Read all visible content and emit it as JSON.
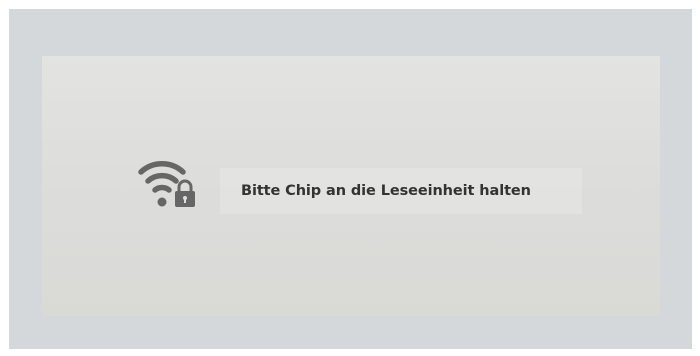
{
  "dialog": {
    "icon": "wifi-lock-icon",
    "message": "Bitte Chip an die Leseeinheit halten"
  },
  "colors": {
    "frame_background": "#d4d8db",
    "panel_background": "#dfdfdd",
    "icon_color": "#666666",
    "text_color": "#333333"
  }
}
